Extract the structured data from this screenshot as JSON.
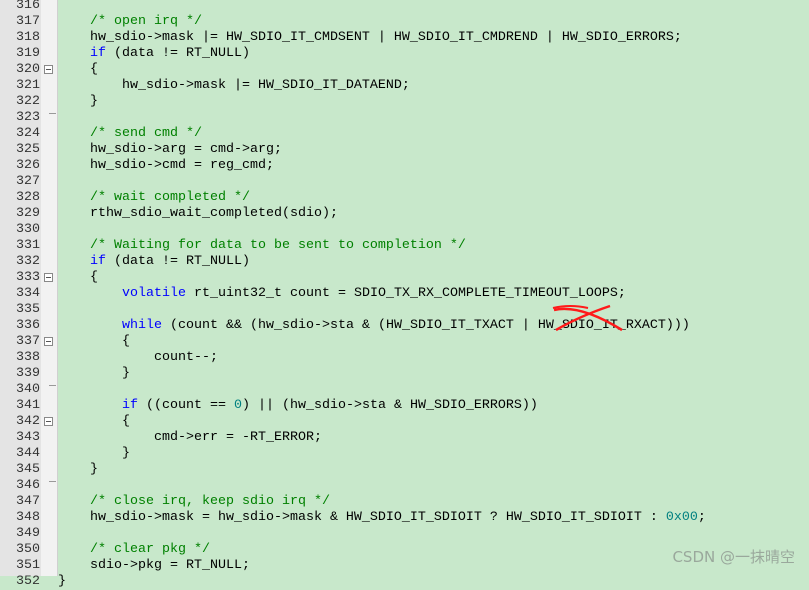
{
  "editor": {
    "first_line": 316,
    "lines": [
      [
        [
          "p",
          ""
        ]
      ],
      [
        [
          "p",
          "    "
        ],
        [
          "c",
          "/* open irq */"
        ]
      ],
      [
        [
          "p",
          "    hw_sdio->mask |= HW_SDIO_IT_CMDSENT | HW_SDIO_IT_CMDREND | HW_SDIO_ERRORS;"
        ]
      ],
      [
        [
          "p",
          "    "
        ],
        [
          "k",
          "if"
        ],
        [
          "p",
          " (data != RT_NULL)"
        ]
      ],
      [
        [
          "p",
          "    {"
        ]
      ],
      [
        [
          "p",
          "        hw_sdio->mask |= HW_SDIO_IT_DATAEND;"
        ]
      ],
      [
        [
          "p",
          "    }"
        ]
      ],
      [
        [
          "p",
          ""
        ]
      ],
      [
        [
          "p",
          "    "
        ],
        [
          "c",
          "/* send cmd */"
        ]
      ],
      [
        [
          "p",
          "    hw_sdio->arg = cmd->arg;"
        ]
      ],
      [
        [
          "p",
          "    hw_sdio->cmd = reg_cmd;"
        ]
      ],
      [
        [
          "p",
          ""
        ]
      ],
      [
        [
          "p",
          "    "
        ],
        [
          "c",
          "/* wait completed */"
        ]
      ],
      [
        [
          "p",
          "    rthw_sdio_wait_completed(sdio);"
        ]
      ],
      [
        [
          "p",
          ""
        ]
      ],
      [
        [
          "p",
          "    "
        ],
        [
          "c",
          "/* Waiting for data to be sent to completion */"
        ]
      ],
      [
        [
          "p",
          "    "
        ],
        [
          "k",
          "if"
        ],
        [
          "p",
          " (data != RT_NULL)"
        ]
      ],
      [
        [
          "p",
          "    {"
        ]
      ],
      [
        [
          "p",
          "        "
        ],
        [
          "k",
          "volatile"
        ],
        [
          "p",
          " rt_uint32_t count = SDIO_TX_RX_COMPLETE_TIMEOUT_LOOPS;"
        ]
      ],
      [
        [
          "p",
          ""
        ]
      ],
      [
        [
          "p",
          "        "
        ],
        [
          "k",
          "while"
        ],
        [
          "p",
          " (count && (hw_sdio->sta & (HW_SDIO_IT_TXACT | HW_SDIO_IT_RXACT)))"
        ]
      ],
      [
        [
          "p",
          "        {"
        ]
      ],
      [
        [
          "p",
          "            count--;"
        ]
      ],
      [
        [
          "p",
          "        }"
        ]
      ],
      [
        [
          "p",
          ""
        ]
      ],
      [
        [
          "p",
          "        "
        ],
        [
          "k",
          "if"
        ],
        [
          "p",
          " ((count == "
        ],
        [
          "n",
          "0"
        ],
        [
          "p",
          ") || (hw_sdio->sta & HW_SDIO_ERRORS))"
        ]
      ],
      [
        [
          "p",
          "        {"
        ]
      ],
      [
        [
          "p",
          "            cmd->err = -RT_ERROR;"
        ]
      ],
      [
        [
          "p",
          "        }"
        ]
      ],
      [
        [
          "p",
          "    }"
        ]
      ],
      [
        [
          "p",
          ""
        ]
      ],
      [
        [
          "p",
          "    "
        ],
        [
          "c",
          "/* close irq, keep sdio irq */"
        ]
      ],
      [
        [
          "p",
          "    hw_sdio->mask = hw_sdio->mask & HW_SDIO_IT_SDIOIT ? HW_SDIO_IT_SDIOIT : "
        ],
        [
          "n",
          "0x00"
        ],
        [
          "p",
          ";"
        ]
      ],
      [
        [
          "p",
          ""
        ]
      ],
      [
        [
          "p",
          "    "
        ],
        [
          "c",
          "/* clear pkg */"
        ]
      ],
      [
        [
          "p",
          "    sdio->pkg = RT_NULL;"
        ]
      ],
      [
        [
          "p",
          "}"
        ]
      ]
    ],
    "fold_open_lines": [
      320,
      333,
      337,
      342
    ],
    "fold_end_lines": [
      323,
      340,
      346
    ],
    "colors": {
      "comment": "#008000",
      "keyword": "#0000ff",
      "number": "#008080",
      "background": "#c8e8cb",
      "annotation": "#ff0000"
    }
  },
  "watermark": "CSDN @一抹晴空"
}
